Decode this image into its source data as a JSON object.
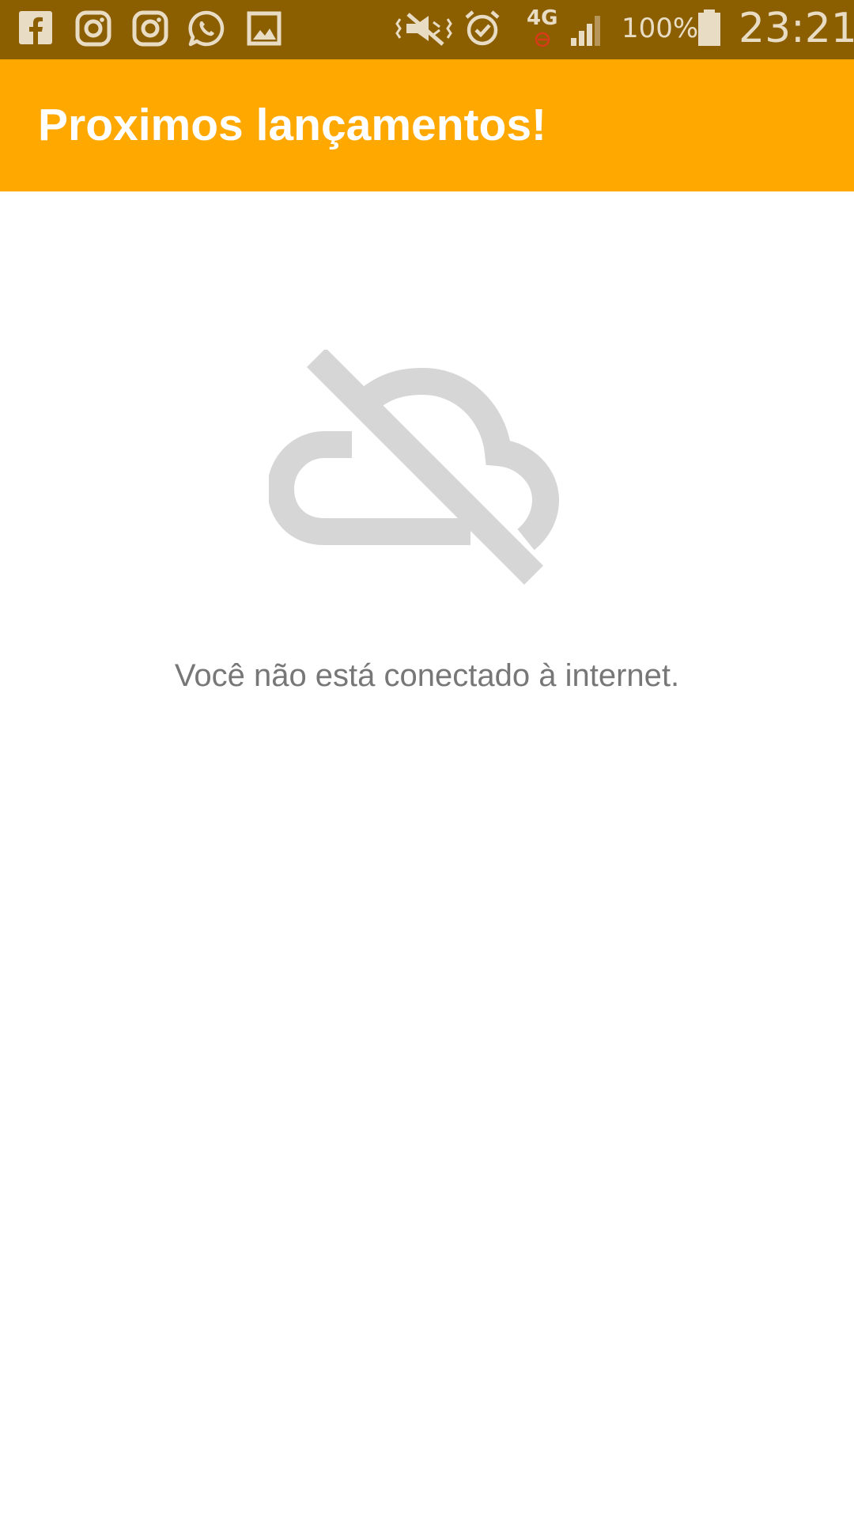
{
  "status_bar": {
    "background": "#8B5E00",
    "notification_icons": [
      "facebook-icon",
      "instagram-icon",
      "instagram-icon",
      "whatsapp-icon",
      "image-icon"
    ],
    "system_icons": [
      "vibrate-mute-icon",
      "alarm-icon",
      "network-4g-icon",
      "signal-icon",
      "battery-icon"
    ],
    "network_type": "4G",
    "battery_percent": "100%",
    "time": "23:21"
  },
  "app_bar": {
    "title": "Proximos lançamentos!",
    "background": "#FFA800"
  },
  "content": {
    "icon": "cloud-off-icon",
    "message": "Você não está conectado à internet."
  }
}
